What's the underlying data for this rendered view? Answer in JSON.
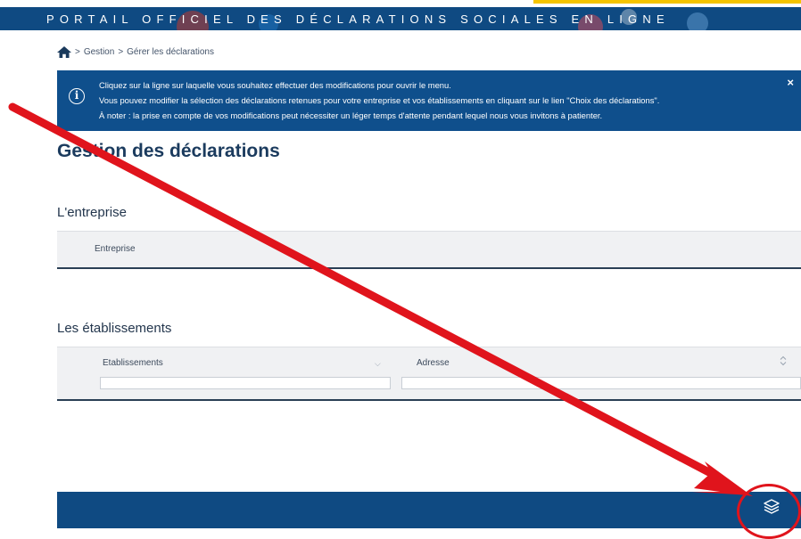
{
  "header": {
    "portal_title": "PORTAIL OFFICIEL DES DÉCLARATIONS SOCIALES EN LIGNE",
    "brand_color": "#0f4a82",
    "accent_color": "#f5c400"
  },
  "breadcrumb": {
    "home_icon": "home-icon",
    "separator": ">",
    "items": [
      "Gestion",
      "Gérer les déclarations"
    ]
  },
  "info_box": {
    "icon": "info-icon",
    "lines": [
      "Cliquez sur la ligne sur laquelle vous souhaitez effectuer des modifications pour ouvrir le menu.",
      "Vous pouvez modifier la sélection des déclarations retenues pour votre entreprise et vos établissements en cliquant sur le lien \"Choix des déclarations\".",
      "À noter : la prise en compte de vos modifications peut nécessiter un léger temps d'attente pendant lequel nous vous invitons à patienter."
    ],
    "close_label": "×"
  },
  "page": {
    "title": "Gestion des déclarations"
  },
  "entreprise": {
    "section_title": "L'entreprise",
    "column": "Entreprise"
  },
  "etablissements": {
    "section_title": "Les établissements",
    "columns": [
      {
        "label": "Etablissements",
        "sort_icon": "chevron-down-icon",
        "filter_value": ""
      },
      {
        "label": "Adresse",
        "sort_icon": "sort-icon",
        "filter_value": ""
      }
    ]
  },
  "footer": {
    "button_icon": "layers-icon"
  },
  "annotation": {
    "arrow_color": "#e0141c",
    "circle_color": "#e0141c"
  }
}
